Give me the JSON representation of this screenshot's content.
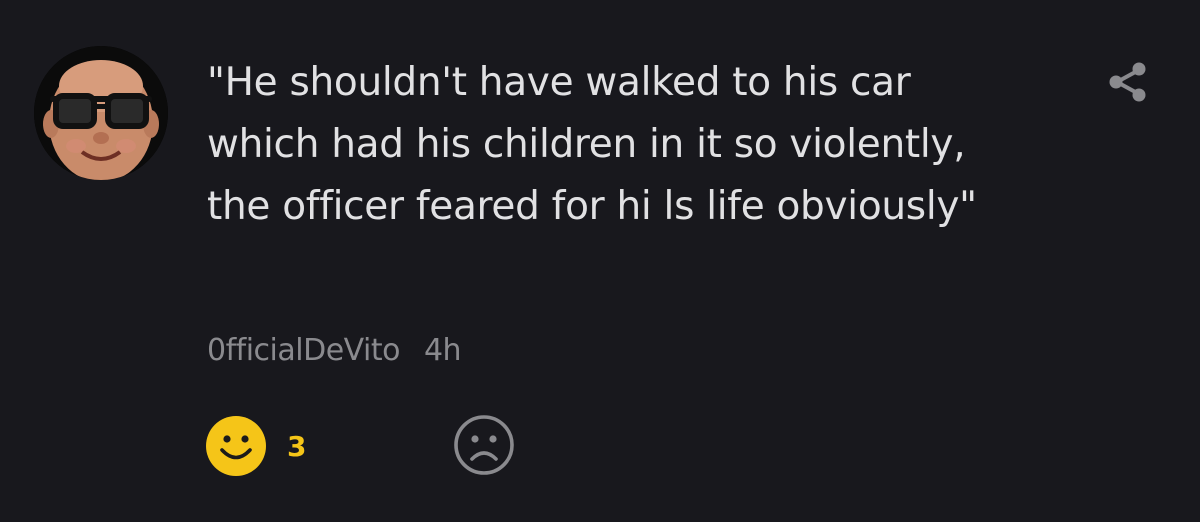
{
  "post": {
    "text": "\"He shouldn't have walked to his car which had his children in it so violently, the officer feared for hi ls life obviously\"",
    "author": "0fficialDeVito",
    "time": "4h",
    "avatar_icon": "user-avatar-photo",
    "share_icon": "share-icon"
  },
  "reactions": {
    "like_icon": "smile-face-icon",
    "like_count": "3",
    "like_color": "#f5c518",
    "dislike_icon": "sad-face-icon",
    "dislike_color": "#8a8a8e"
  },
  "colors": {
    "background": "#18181d",
    "text": "#e1e1e3",
    "muted": "#8a8a8e"
  }
}
